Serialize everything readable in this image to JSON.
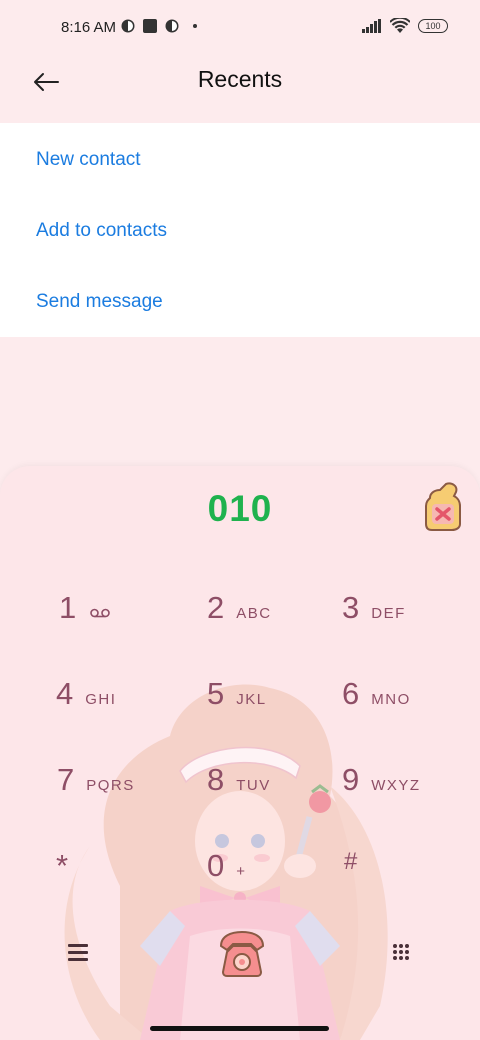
{
  "status_bar": {
    "time": "8:16 AM",
    "battery": "100"
  },
  "header": {
    "title": "Recents",
    "back_icon": "arrow-left-icon"
  },
  "menu": {
    "items": [
      {
        "label": "New contact"
      },
      {
        "label": "Add to contacts"
      },
      {
        "label": "Send message"
      }
    ]
  },
  "dialer": {
    "number": "010",
    "keys": [
      {
        "digit": "1",
        "letters": ""
      },
      {
        "digit": "2",
        "letters": "ABC"
      },
      {
        "digit": "3",
        "letters": "DEF"
      },
      {
        "digit": "4",
        "letters": "GHI"
      },
      {
        "digit": "5",
        "letters": "JKL"
      },
      {
        "digit": "6",
        "letters": "MNO"
      },
      {
        "digit": "7",
        "letters": "PQRS"
      },
      {
        "digit": "8",
        "letters": "TUV"
      },
      {
        "digit": "9",
        "letters": "WXYZ"
      },
      {
        "digit": "*",
        "letters": ""
      },
      {
        "digit": "0",
        "letters": "+"
      },
      {
        "digit": "#",
        "letters": ""
      }
    ]
  },
  "colors": {
    "link": "#1b7ce0",
    "number": "#1fb24e",
    "key_text": "#8e4e66",
    "background": "#fdebed"
  }
}
